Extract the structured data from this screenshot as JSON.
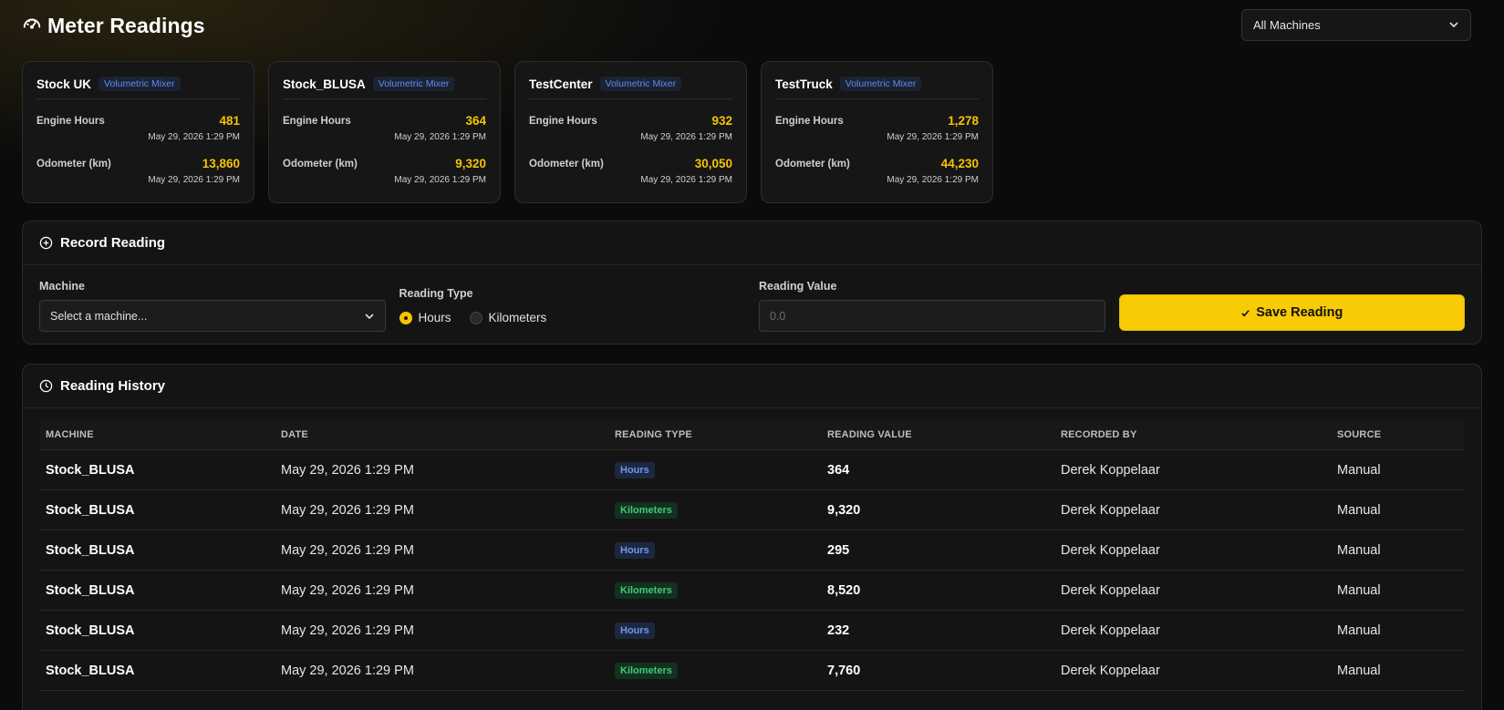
{
  "header": {
    "title": "Meter Readings",
    "machine_filter": "All Machines"
  },
  "cards": [
    {
      "name": "Stock UK",
      "type": "Volumetric Mixer",
      "engine_label": "Engine Hours",
      "engine_value": "481",
      "engine_date": "May 29, 2026 1:29 PM",
      "odo_label": "Odometer (km)",
      "odo_value": "13,860",
      "odo_date": "May 29, 2026 1:29 PM"
    },
    {
      "name": "Stock_BLUSA",
      "type": "Volumetric Mixer",
      "engine_label": "Engine Hours",
      "engine_value": "364",
      "engine_date": "May 29, 2026 1:29 PM",
      "odo_label": "Odometer (km)",
      "odo_value": "9,320",
      "odo_date": "May 29, 2026 1:29 PM"
    },
    {
      "name": "TestCenter",
      "type": "Volumetric Mixer",
      "engine_label": "Engine Hours",
      "engine_value": "932",
      "engine_date": "May 29, 2026 1:29 PM",
      "odo_label": "Odometer (km)",
      "odo_value": "30,050",
      "odo_date": "May 29, 2026 1:29 PM"
    },
    {
      "name": "TestTruck",
      "type": "Volumetric Mixer",
      "engine_label": "Engine Hours",
      "engine_value": "1,278",
      "engine_date": "May 29, 2026 1:29 PM",
      "odo_label": "Odometer (km)",
      "odo_value": "44,230",
      "odo_date": "May 29, 2026 1:29 PM"
    }
  ],
  "record": {
    "title": "Record Reading",
    "machine_label": "Machine",
    "machine_value": "Select a machine...",
    "type_label": "Reading Type",
    "type_options": [
      "Hours",
      "Kilometers"
    ],
    "type_selected": "Hours",
    "value_label": "Reading Value",
    "value_placeholder": "0.0",
    "save_label": "Save Reading"
  },
  "history": {
    "title": "Reading History",
    "columns": [
      "MACHINE",
      "DATE",
      "READING TYPE",
      "READING VALUE",
      "RECORDED BY",
      "SOURCE"
    ],
    "rows": [
      {
        "machine": "Stock_BLUSA",
        "date": "May 29, 2026 1:29 PM",
        "type": "Hours",
        "value": "364",
        "recorded_by": "Derek Koppelaar",
        "source": "Manual"
      },
      {
        "machine": "Stock_BLUSA",
        "date": "May 29, 2026 1:29 PM",
        "type": "Kilometers",
        "value": "9,320",
        "recorded_by": "Derek Koppelaar",
        "source": "Manual"
      },
      {
        "machine": "Stock_BLUSA",
        "date": "May 29, 2026 1:29 PM",
        "type": "Hours",
        "value": "295",
        "recorded_by": "Derek Koppelaar",
        "source": "Manual"
      },
      {
        "machine": "Stock_BLUSA",
        "date": "May 29, 2026 1:29 PM",
        "type": "Kilometers",
        "value": "8,520",
        "recorded_by": "Derek Koppelaar",
        "source": "Manual"
      },
      {
        "machine": "Stock_BLUSA",
        "date": "May 29, 2026 1:29 PM",
        "type": "Hours",
        "value": "232",
        "recorded_by": "Derek Koppelaar",
        "source": "Manual"
      },
      {
        "machine": "Stock_BLUSA",
        "date": "May 29, 2026 1:29 PM",
        "type": "Kilometers",
        "value": "7,760",
        "recorded_by": "Derek Koppelaar",
        "source": "Manual"
      }
    ]
  },
  "colors": {
    "accent": "#f5c400",
    "hours_badge": "#6e98ee",
    "km_badge": "#3fca7a",
    "type_badge": "#5b8df0"
  },
  "icons": {
    "title": "speedometer-icon",
    "filter": "chevron-down-icon",
    "record": "plus-circle-icon",
    "history": "clock-icon",
    "save": "check-icon"
  }
}
